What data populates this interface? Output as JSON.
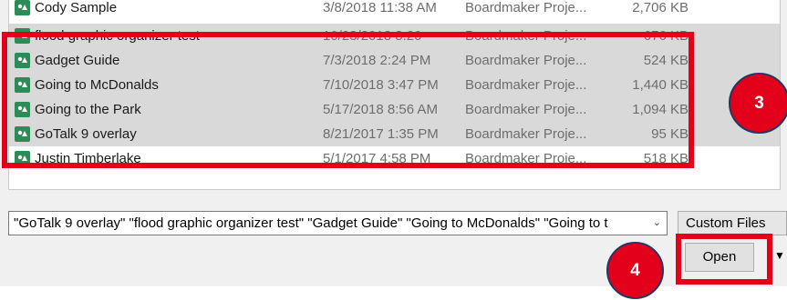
{
  "files": [
    {
      "name": "Cody Sample",
      "date": "3/8/2018 11:38 AM",
      "type": "Boardmaker Proje...",
      "size": "2,706 KB",
      "selected": false
    },
    {
      "name": "flood graphic organizer test",
      "date": "10/23/2018 8:20",
      "type": "Boardmaker Proje...",
      "size": "676 KB",
      "selected": true
    },
    {
      "name": "Gadget Guide",
      "date": "7/3/2018 2:24 PM",
      "type": "Boardmaker Proje...",
      "size": "524 KB",
      "selected": true
    },
    {
      "name": "Going to McDonalds",
      "date": "7/10/2018 3:47 PM",
      "type": "Boardmaker Proje...",
      "size": "1,440 KB",
      "selected": true
    },
    {
      "name": "Going to the Park",
      "date": "5/17/2018 8:56 AM",
      "type": "Boardmaker Proje...",
      "size": "1,094 KB",
      "selected": true
    },
    {
      "name": "GoTalk 9 overlay",
      "date": "8/21/2017 1:35 PM",
      "type": "Boardmaker Proje...",
      "size": "95 KB",
      "selected": true
    },
    {
      "name": "Justin Timberlake",
      "date": "5/1/2017 4:58 PM",
      "type": "Boardmaker Proje...",
      "size": "518 KB",
      "selected": false
    }
  ],
  "filename_field": {
    "value": "\"GoTalk 9 overlay\" \"flood graphic organizer test\" \"Gadget Guide\" \"Going to McDonalds\" \"Going to t"
  },
  "filetype": {
    "label": "Custom Files"
  },
  "open_button": {
    "label": "Open"
  },
  "callouts": {
    "step3": "3",
    "step4": "4"
  },
  "colors": {
    "highlight": "#e2001a",
    "callout_border": "#1f3864",
    "icon": "#2e8b57",
    "selected_row": "#d9d9d9"
  }
}
